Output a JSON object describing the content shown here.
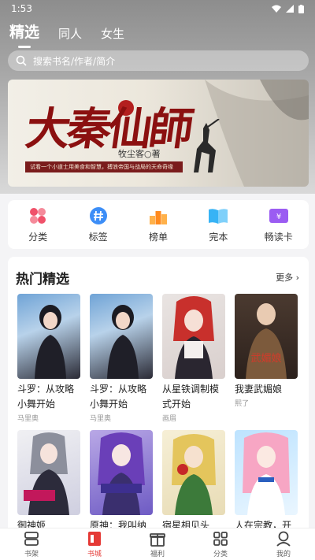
{
  "status": {
    "time": "1:53"
  },
  "tabs": [
    {
      "label": "精选"
    },
    {
      "label": "同人"
    },
    {
      "label": "女生"
    }
  ],
  "search": {
    "placeholder": "搜索书名/作者/简介"
  },
  "banner": {
    "title": "大秦仙師",
    "author": "牧尘客○著",
    "tagline": "试看一个小道士用美食和智慧，搏浪帝国与战局的天命奇缘"
  },
  "quick_links": [
    {
      "label": "分类",
      "icon": "grid-icon",
      "color": "#f0516a"
    },
    {
      "label": "标签",
      "icon": "hash-icon",
      "color": "#3d8ef7"
    },
    {
      "label": "榜单",
      "icon": "podium-icon",
      "color": "#ff9a2e"
    },
    {
      "label": "完本",
      "icon": "book-open-icon",
      "color": "#37b3f5"
    },
    {
      "label": "畅读卡",
      "icon": "ticket-icon",
      "color": "#9b5cf2"
    }
  ],
  "hot": {
    "title": "热门精选",
    "more": "更多",
    "books": [
      {
        "title": "斗罗：从攻略小舞开始",
        "author": "马里奥"
      },
      {
        "title": "斗罗：从攻略小舞开始",
        "author": "马里奥"
      },
      {
        "title": "从星铁调制模式开始",
        "author": "画眉"
      },
      {
        "title": "我妻武媚娘",
        "author": "熙了"
      },
      {
        "title": "御神姬",
        "author": ""
      },
      {
        "title": "原神：我叫纳",
        "author": ""
      },
      {
        "title": "宿星相见头",
        "author": ""
      },
      {
        "title": "人在宗教，开",
        "author": ""
      }
    ]
  },
  "nav": [
    {
      "label": "书架",
      "icon": "shelf-icon"
    },
    {
      "label": "书城",
      "icon": "bookstore-icon"
    },
    {
      "label": "福利",
      "icon": "gift-icon"
    },
    {
      "label": "分类",
      "icon": "category-icon"
    },
    {
      "label": "我的",
      "icon": "profile-icon"
    }
  ],
  "colors": {
    "accent": "#e53935",
    "banner_title": "#8b1010"
  }
}
